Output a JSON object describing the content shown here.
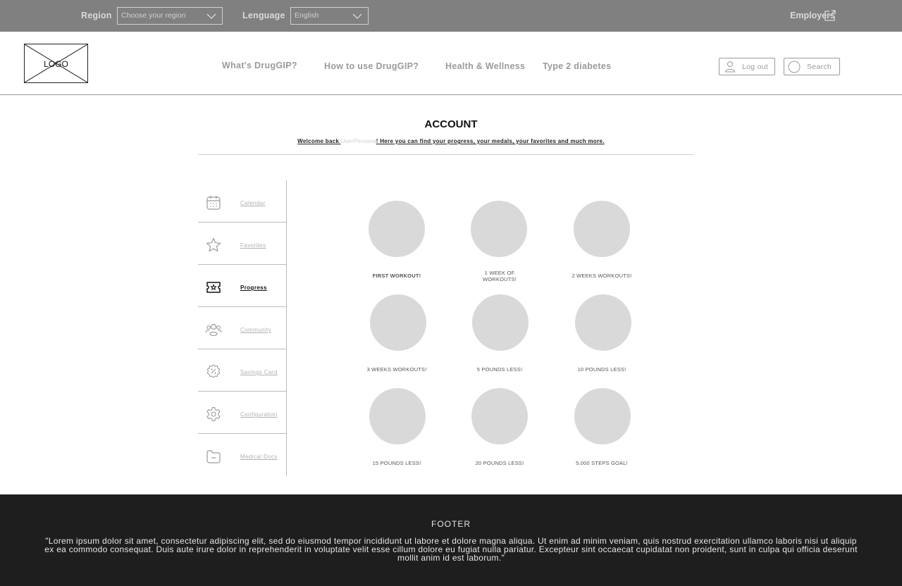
{
  "topbar": {
    "region_label": "Region",
    "region_placeholder": "Choose your region",
    "language_label": "Lenguage",
    "language_value": "English",
    "employers_label": "Employers"
  },
  "header": {
    "logo_text": "LOGO",
    "nav": [
      "What's DrugGIP?",
      "How to use DrugGIP?",
      "Health & Wellness",
      "Type 2 diabetes"
    ],
    "logout_label": "Log out",
    "search_label": "Search"
  },
  "account": {
    "title": "ACCOUNT",
    "welcome_prefix": "Welcome back ",
    "welcome_name": "UserPersona",
    "welcome_suffix": "! Here you can find your progress, your medals, your favorites and much more."
  },
  "sidebar": {
    "active": "Progress",
    "items": [
      {
        "label": "Calendar",
        "icon": "calendar-icon"
      },
      {
        "label": "Favorites",
        "icon": "star-icon"
      },
      {
        "label": "Progress",
        "icon": "ticket-star-icon"
      },
      {
        "label": "Community",
        "icon": "people-icon"
      },
      {
        "label": "Savings Card",
        "icon": "discount-badge-icon"
      },
      {
        "label": "Configuration",
        "icon": "gear-icon"
      },
      {
        "label": "Medical Docs",
        "icon": "folder-icon"
      }
    ]
  },
  "medals": [
    {
      "label": "FIRST WORKOUT!",
      "bold": true
    },
    {
      "label": "1 WEEK OF WORKOUTS!",
      "bold": false
    },
    {
      "label": "2 WEEKS WORKOUTS!",
      "bold": false
    },
    {
      "label": "3 WEEKS WORKOUTS!",
      "bold": false
    },
    {
      "label": "5 POUNDS LESS!",
      "bold": false
    },
    {
      "label": "10 POUNDS LESS!",
      "bold": false
    },
    {
      "label": "15 POUNDS LESS!",
      "bold": false
    },
    {
      "label": "20 POUNDS LESS!",
      "bold": false
    },
    {
      "label": "5,000 STEPS GOAL!",
      "bold": false
    }
  ],
  "footer": {
    "title": "FOOTER",
    "text": "\"Lorem ipsum dolor sit amet, consectetur adipiscing elit, sed do eiusmod tempor incididunt ut labore et dolore magna aliqua. Ut enim ad minim veniam, quis nostrud exercitation ullamco laboris nisi ut aliquip ex ea commodo consequat. Duis aute irure dolor in reprehenderit in voluptate velit esse cillum dolore eu fugiat nulla pariatur. Excepteur sint occaecat cupidatat non proident, sunt in culpa qui officia deserunt mollit anim id est laborum.\""
  },
  "colors": {
    "topbar_bg": "#808080",
    "footer_bg": "#1e1e1e",
    "medal_fill": "#d9d9d9",
    "muted_text": "#9a9a9a"
  }
}
